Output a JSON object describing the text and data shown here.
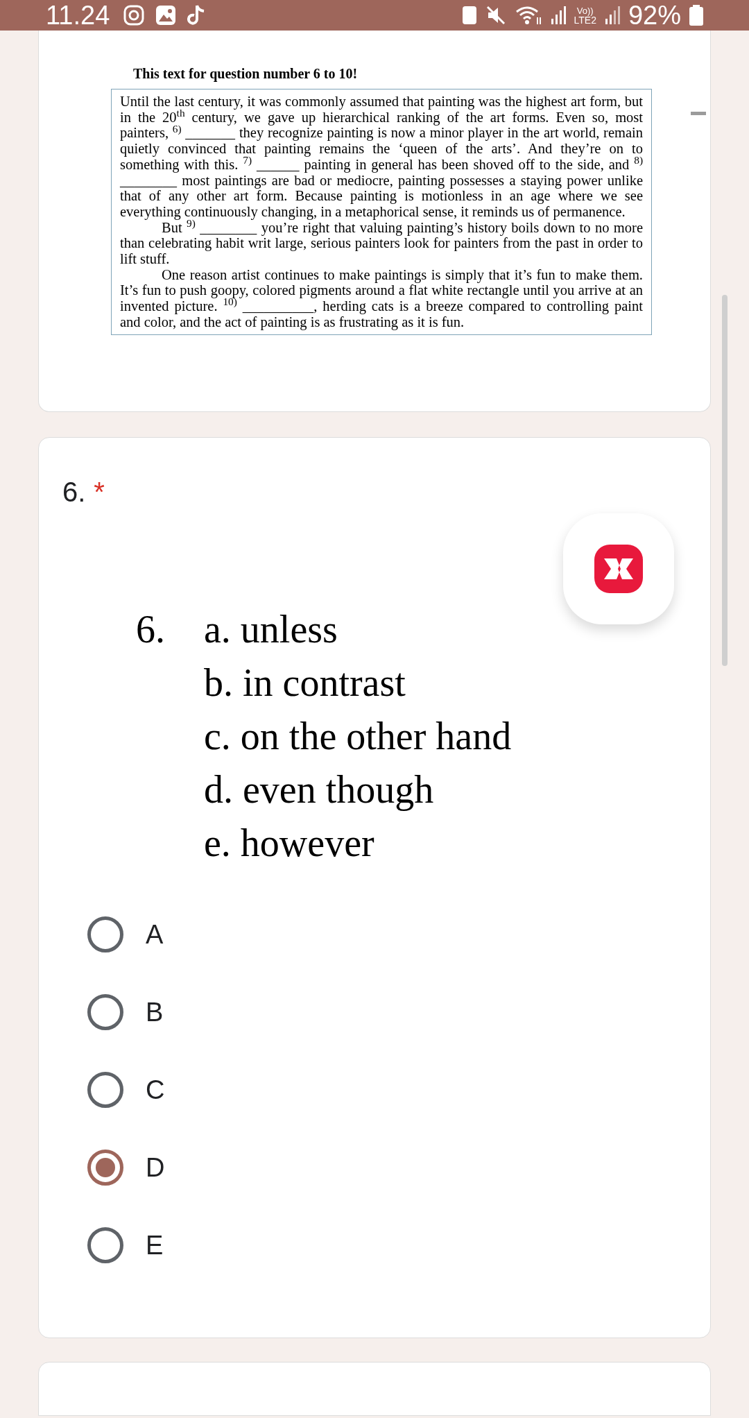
{
  "status_bar": {
    "time": "11.24",
    "volte": "Vo))",
    "network": "LTE2",
    "battery": "92%"
  },
  "passage": {
    "heading": "This text for question number 6 to 10!",
    "paragraphs": [
      {
        "indent": false,
        "text": "Until the last century, it was commonly assumed that painting was the highest art form, but in the 20$^{th}$ century, we gave up hierarchical ranking of the art forms. Even so, most painters, $^{6)}$ _______ they recognize painting is now a minor player in the art world, remain quietly convinced that painting remains the ‘queen of the arts’. And they’re on to something with this. $^{7)}$ ______ painting in general has been shoved off to the side, and $^{8)}$ ________ most paintings are bad or mediocre, painting possesses a staying power unlike that of any other art form. Because painting is motionless in an age where we see everything continuously changing, in a metaphorical sense, it reminds us of permanence."
      },
      {
        "indent": true,
        "text": "But $^{9)}$ ________ you’re right that valuing painting’s history boils down to no more than celebrating habit writ large, serious painters look for painters from the past in order to lift stuff."
      },
      {
        "indent": true,
        "text": "One reason artist continues to make paintings is simply that it’s fun to make them. It’s fun to push goopy, colored pigments around a flat white rectangle until you arrive at an invented picture. $^{10)}$ __________, herding cats is a breeze compared to controlling paint and color, and the act of painting is as frustrating as it is fun."
      }
    ]
  },
  "question": {
    "number": "6.",
    "required_mark": "*",
    "image_number": "6.",
    "image_options": [
      "a. unless",
      "b. in contrast",
      "c. on the other hand",
      "d. even though",
      "e. however"
    ],
    "choices": [
      {
        "label": "A",
        "selected": false
      },
      {
        "label": "B",
        "selected": false
      },
      {
        "label": "C",
        "selected": false
      },
      {
        "label": "D",
        "selected": true
      },
      {
        "label": "E",
        "selected": false
      }
    ]
  }
}
